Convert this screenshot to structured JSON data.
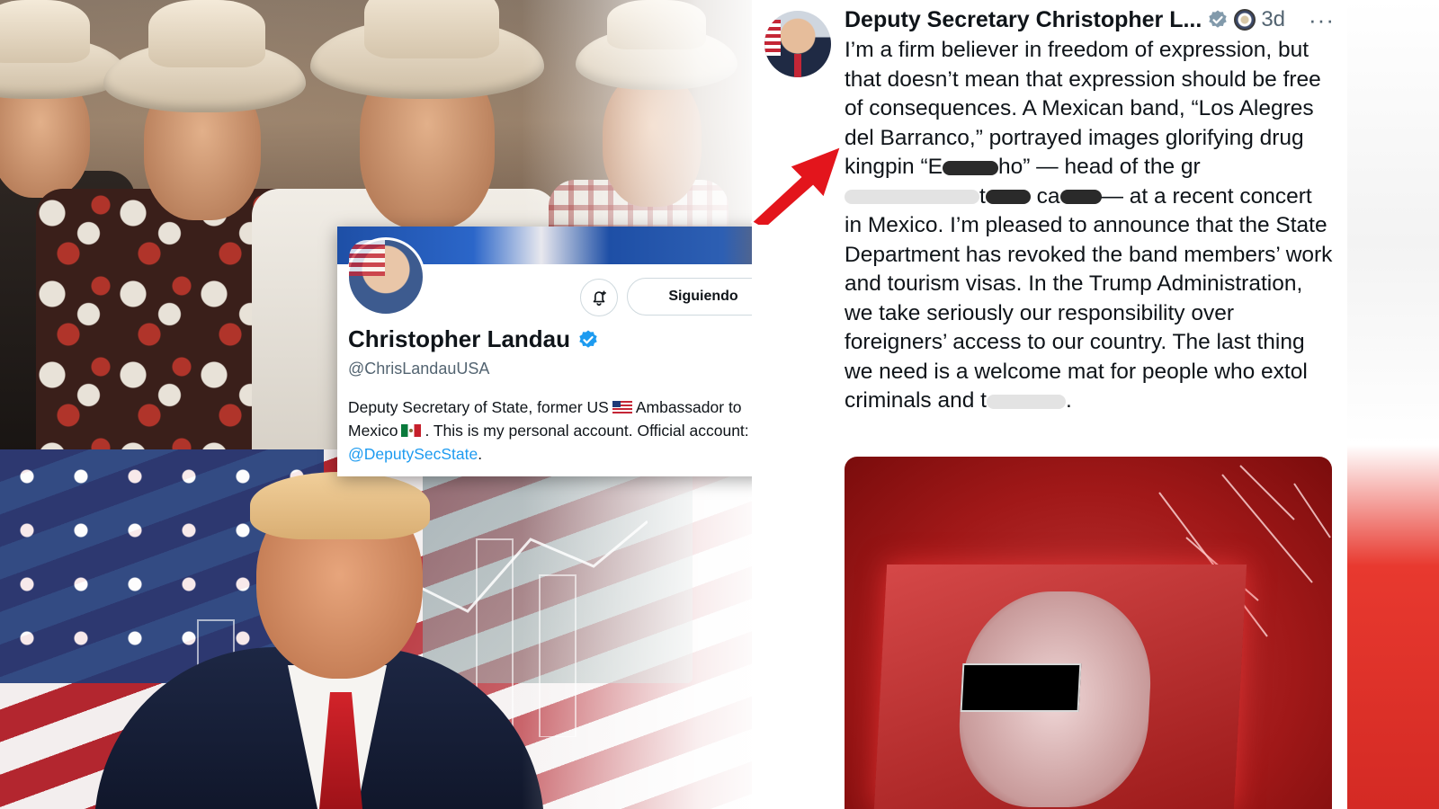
{
  "profile_card": {
    "follow_label": "Siguiendo",
    "name": "Christopher Landau",
    "handle": "@ChrisLandauUSA",
    "bio_part1": "Deputy Secretary of State, former US",
    "bio_part2": "Ambassador to Mexico",
    "bio_part3": ". This is my personal account. Official account:",
    "bio_link": "@DeputySecState",
    "bio_end": "."
  },
  "tweet": {
    "author": "Deputy Secretary Christopher L...",
    "age": "3d",
    "more": "···",
    "text_1": "I’m a firm believer in freedom of expression, but that doesn’t mean that expression should be free of consequences. A Mexican band, “Los Alegres del Barranco,” portrayed images glorifying drug kingpin “E",
    "text_2": "ho” — head of the gr",
    "text_3": "t",
    "text_4": " ca",
    "text_5": "— at a recent concert in Mexico. I’m pleased to announce that the State Department has revoked the band members’ work and tourism visas. In the Trump Administration, we take seriously our responsibility over foreigners’ access to our country. The last thing we need is a welcome mat for people who extol criminals and t",
    "text_6": "."
  },
  "colors": {
    "verified_blue": "#1d9bf0",
    "gray_badge": "#829aab",
    "arrow_red": "#e3151c",
    "text_dark": "#0f1419",
    "text_gray": "#536471"
  },
  "icons": [
    "verified-badge-icon",
    "state-department-seal-icon",
    "more-icon",
    "bell-plus-icon",
    "us-flag-icon",
    "mexico-flag-icon",
    "red-arrow-icon"
  ]
}
